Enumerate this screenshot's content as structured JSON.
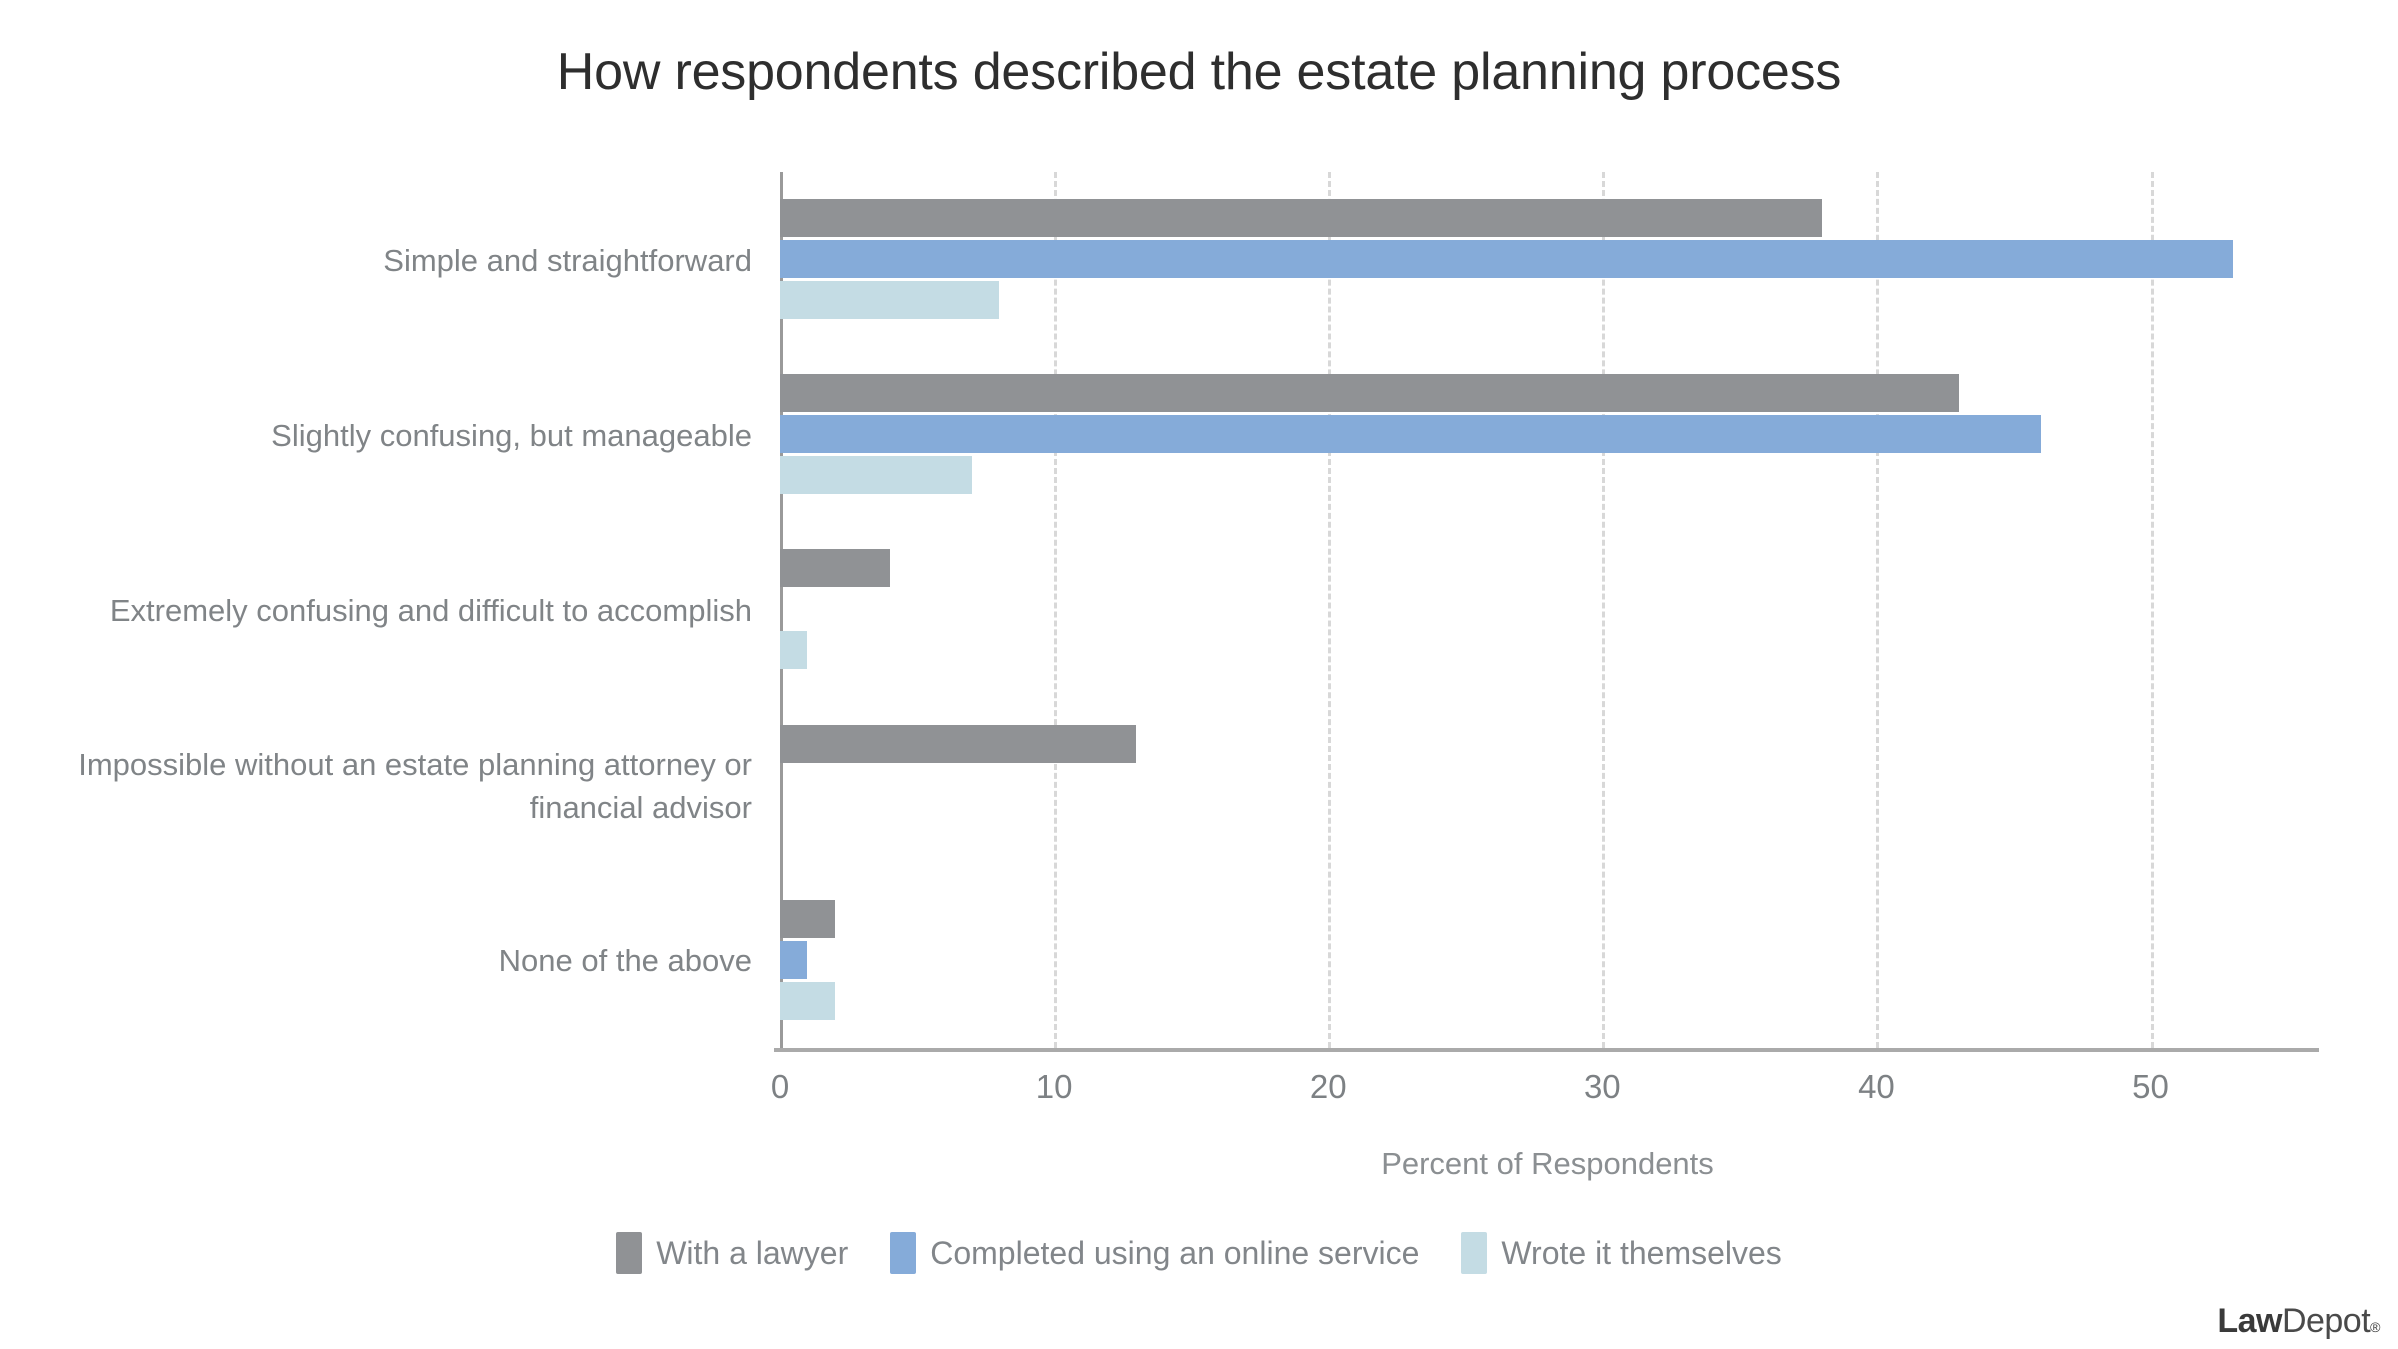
{
  "chart_data": {
    "type": "bar",
    "orientation": "horizontal",
    "title": "How respondents described the estate planning process",
    "xlabel": "Percent of Respondents",
    "ylabel": "",
    "xlim": [
      0,
      56
    ],
    "xticks": [
      0,
      10,
      20,
      30,
      40,
      50
    ],
    "xticklabels": [
      "0",
      "10",
      "20",
      "30",
      "40",
      "50"
    ],
    "grid": "vertical-dashed",
    "legend_position": "bottom-center",
    "categories": [
      "Simple and straightforward",
      "Slightly confusing, but manageable",
      "Extremely confusing and difficult to accomplish",
      "Impossible without an estate planning attorney or financial advisor",
      "None of the above"
    ],
    "series": [
      {
        "name": "With a lawyer",
        "color": "#909295",
        "values": [
          38,
          43,
          4,
          13,
          2
        ]
      },
      {
        "name": "Completed using an online service",
        "color": "#85abd9",
        "values": [
          53,
          46,
          0,
          0,
          1
        ]
      },
      {
        "name": "Wrote it themselves",
        "color": "#c4dce4",
        "values": [
          8,
          7,
          1,
          0,
          2
        ]
      }
    ]
  },
  "branding": {
    "logo_law": "Law",
    "logo_depot": "Depot",
    "logo_registered": "®"
  }
}
